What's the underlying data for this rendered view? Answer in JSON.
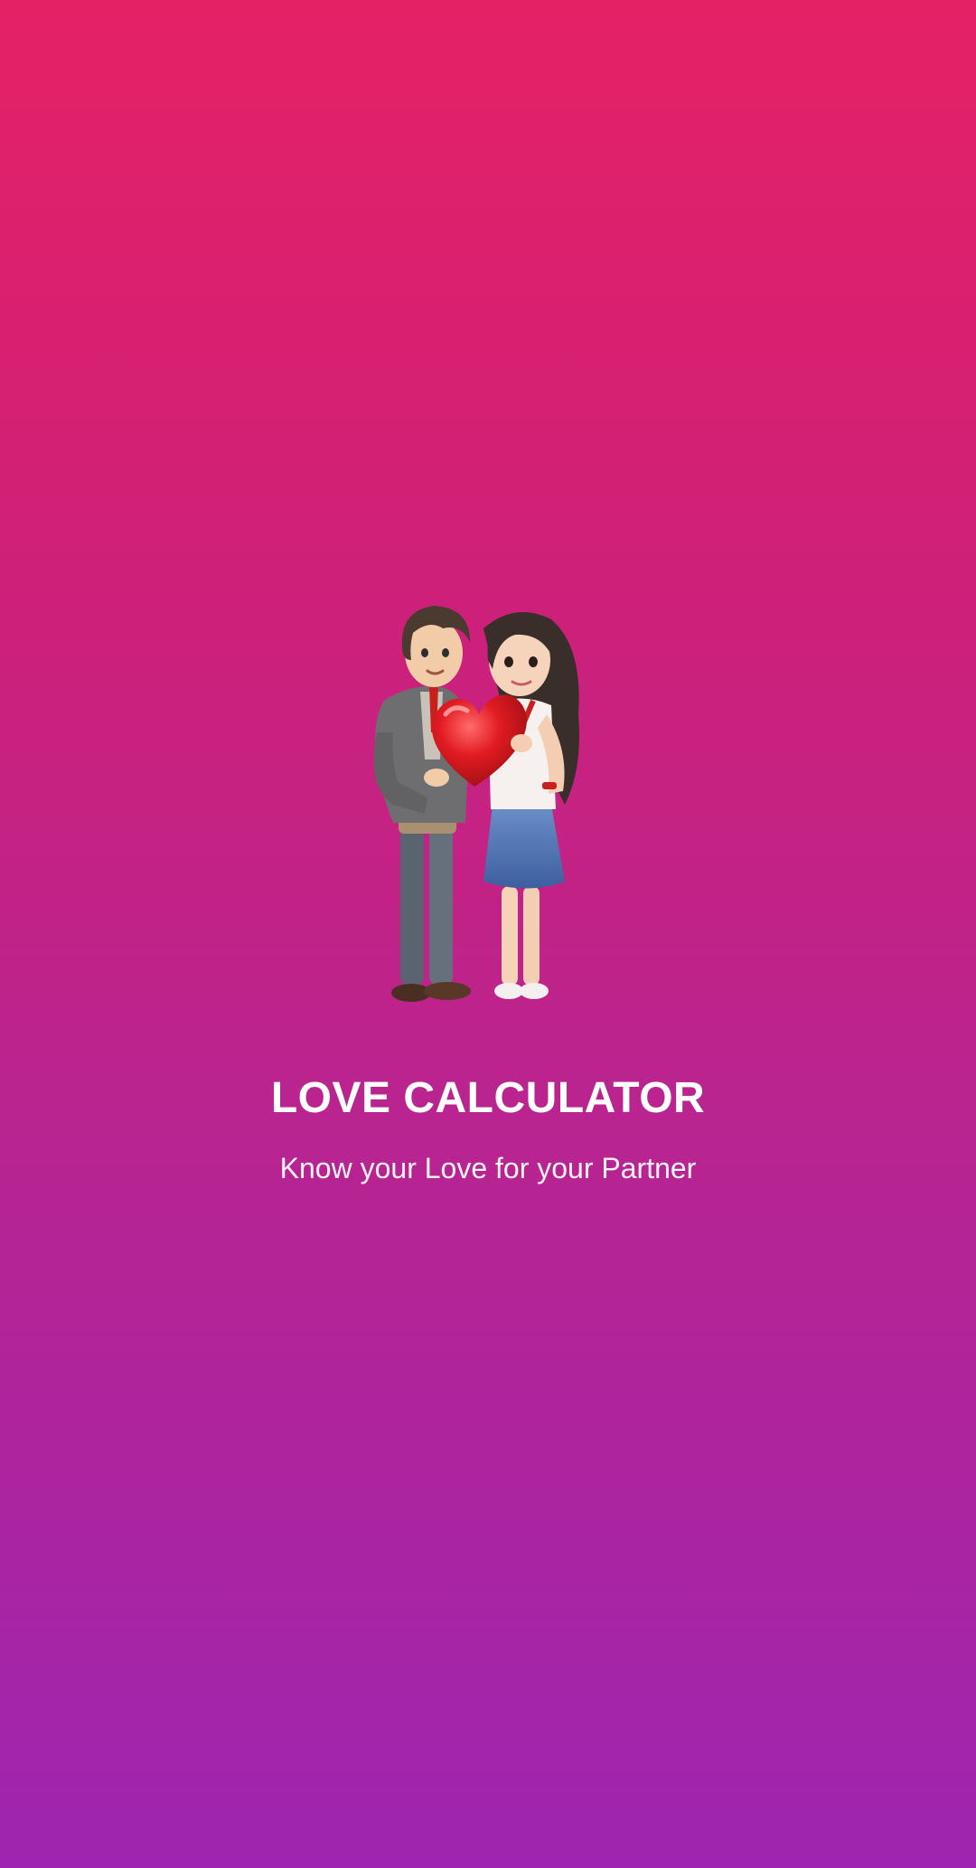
{
  "splash": {
    "title": "LOVE CALCULATOR",
    "subtitle": "Know your Love for your Partner",
    "illustration_icon": "couple-holding-heart-icon"
  },
  "colors": {
    "gradient_top": "#E52165",
    "gradient_bottom": "#9E25B0",
    "text": "#FFFFFF",
    "heart": "#E11B22"
  }
}
